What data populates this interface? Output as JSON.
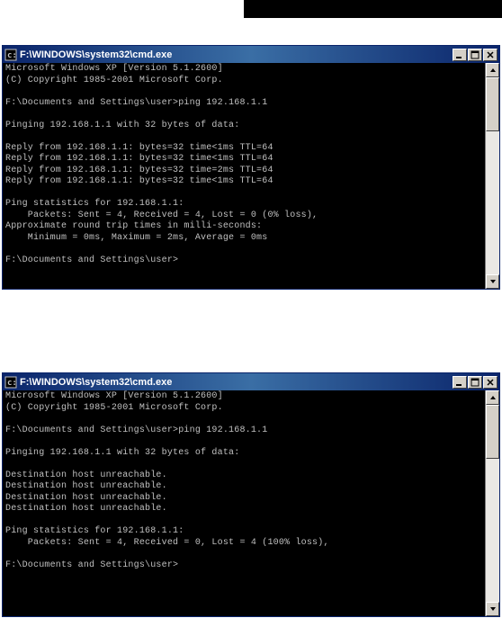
{
  "windows": [
    {
      "title": "F:\\WINDOWS\\system32\\cmd.exe",
      "content": "Microsoft Windows XP [Version 5.1.2600]\n(C) Copyright 1985-2001 Microsoft Corp.\n\nF:\\Documents and Settings\\user>ping 192.168.1.1\n\nPinging 192.168.1.1 with 32 bytes of data:\n\nReply from 192.168.1.1: bytes=32 time<1ms TTL=64\nReply from 192.168.1.1: bytes=32 time<1ms TTL=64\nReply from 192.168.1.1: bytes=32 time=2ms TTL=64\nReply from 192.168.1.1: bytes=32 time<1ms TTL=64\n\nPing statistics for 192.168.1.1:\n    Packets: Sent = 4, Received = 4, Lost = 0 (0% loss),\nApproximate round trip times in milli-seconds:\n    Minimum = 0ms, Maximum = 2ms, Average = 0ms\n\nF:\\Documents and Settings\\user>"
    },
    {
      "title": "F:\\WINDOWS\\system32\\cmd.exe",
      "content": "Microsoft Windows XP [Version 5.1.2600]\n(C) Copyright 1985-2001 Microsoft Corp.\n\nF:\\Documents and Settings\\user>ping 192.168.1.1\n\nPinging 192.168.1.1 with 32 bytes of data:\n\nDestination host unreachable.\nDestination host unreachable.\nDestination host unreachable.\nDestination host unreachable.\n\nPing statistics for 192.168.1.1:\n    Packets: Sent = 4, Received = 0, Lost = 4 (100% loss),\n\nF:\\Documents and Settings\\user>"
    }
  ]
}
